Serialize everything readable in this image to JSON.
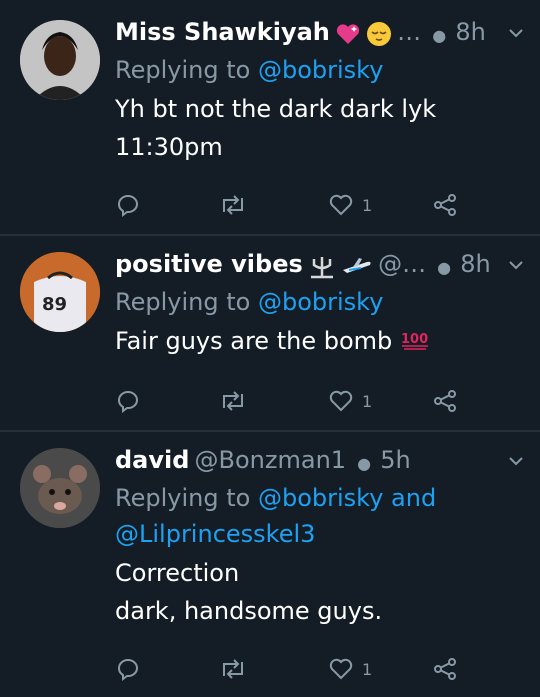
{
  "tweets": [
    {
      "name": "Miss Shawkiyah",
      "handle": "…",
      "time": "8h",
      "reply_prefix": "Replying to",
      "reply_to": "@bobrisky",
      "reply_to2": "",
      "reply_and": "",
      "lines": [
        "Yh bt not the dark dark lyk",
        "11:30pm"
      ],
      "likes": "1",
      "avatar_bg": "#bdbdbd"
    },
    {
      "name": "positive vibes",
      "handle": "@…",
      "time": "8h",
      "reply_prefix": "Replying to",
      "reply_to": "@bobrisky",
      "reply_to2": "",
      "reply_and": "",
      "lines": [
        "Fair guys are the bomb"
      ],
      "likes": "1",
      "avatar_bg": "#c86a2c"
    },
    {
      "name": "david",
      "handle": "@Bonzman1",
      "time": "5h",
      "reply_prefix": "Replying to",
      "reply_to": "@bobrisky",
      "reply_and": "and",
      "reply_to2": "@Lilprincesskel3",
      "lines": [
        "Correction",
        "dark, handsome guys."
      ],
      "likes": "1",
      "avatar_bg": "#3a3a3a"
    }
  ],
  "icons": [
    "reply-icon",
    "retweet-icon",
    "like-icon",
    "share-icon",
    "chevron-down-icon",
    "heart-emoji",
    "relieved-emoji",
    "trident-emoji",
    "airplane-emoji",
    "hundred-emoji"
  ],
  "colors": {
    "background": "#141d26",
    "link": "#1da1f2",
    "muted": "#8899a6",
    "divider": "#24303b"
  }
}
